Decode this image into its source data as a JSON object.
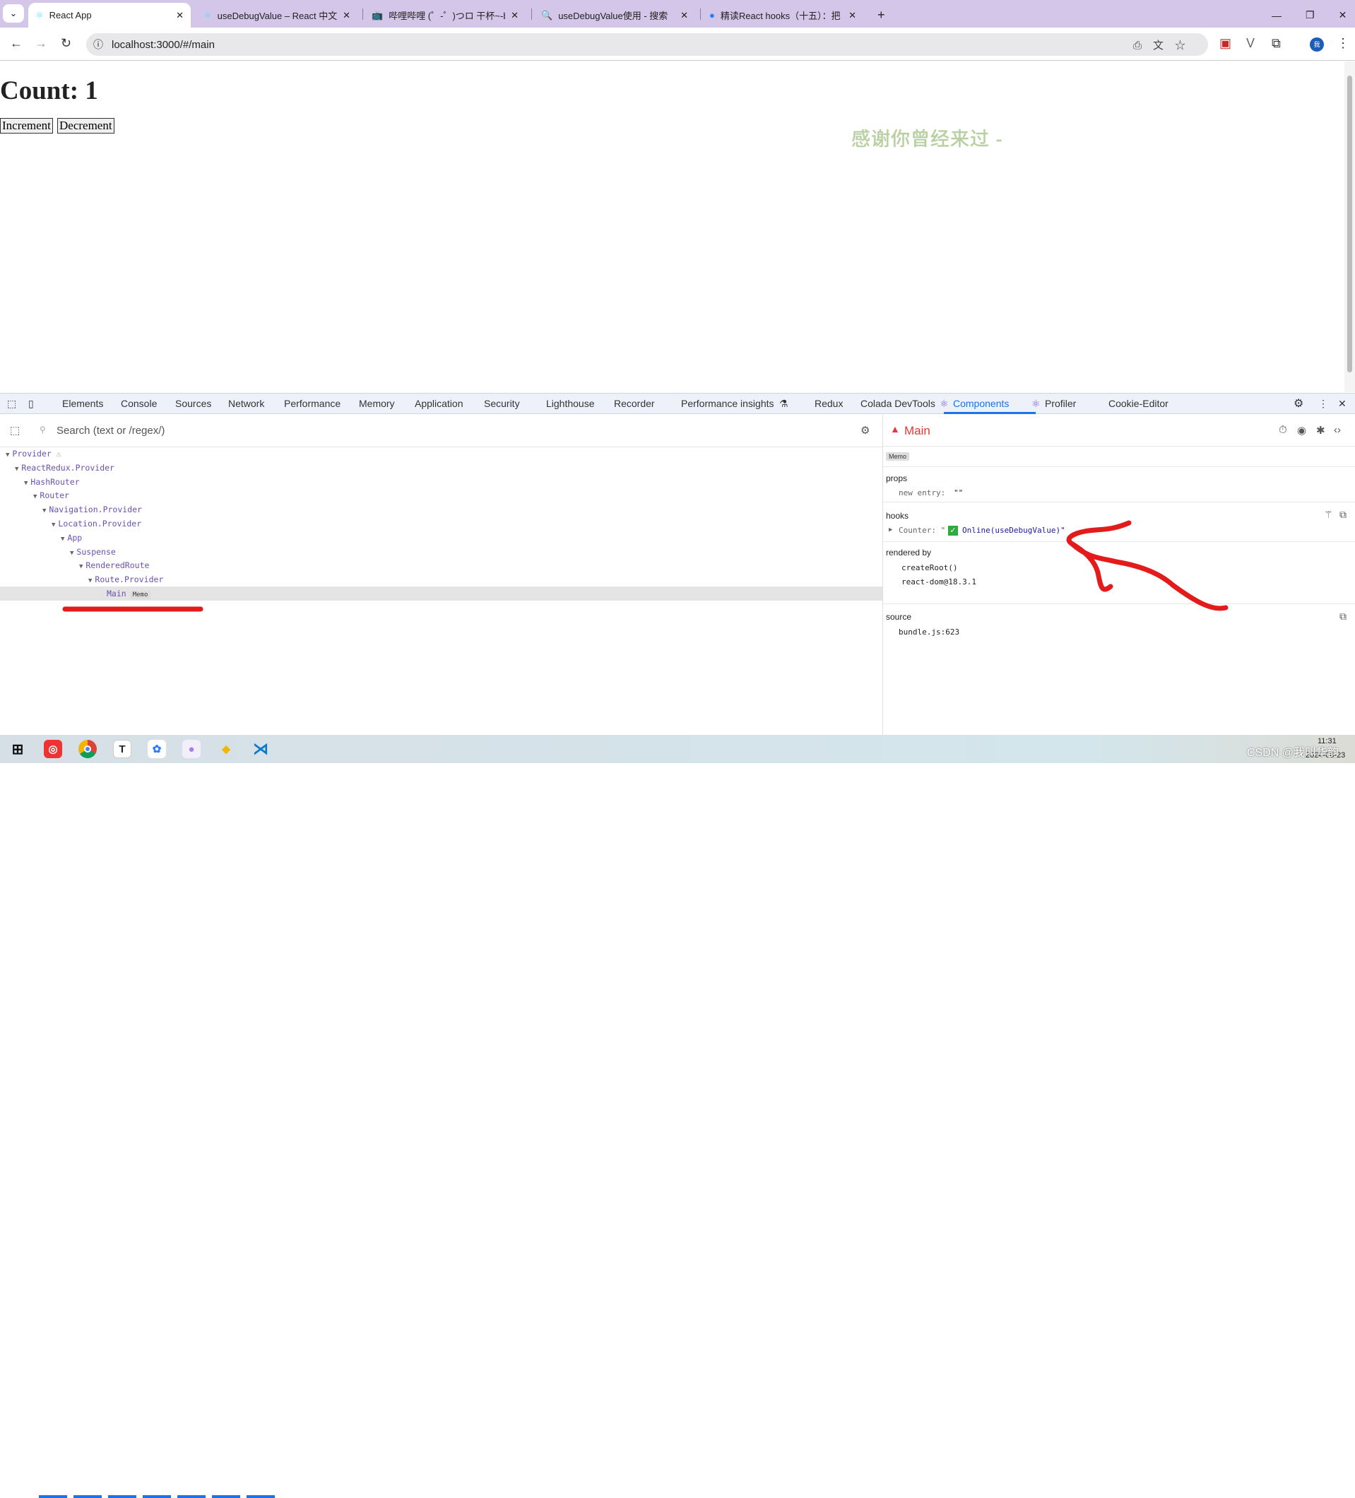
{
  "browser": {
    "tabs": [
      {
        "title": "React App",
        "active": true
      },
      {
        "title": "useDebugValue – React 中文文档"
      },
      {
        "title": "哔哩哔哩 (゜-゜)つロ 干杯~-bilibili"
      },
      {
        "title": "useDebugValue使用 - 搜索"
      },
      {
        "title": "精读React hooks（十五）：把"
      }
    ],
    "new_tab": "+",
    "url": "localhost:3000/#/main"
  },
  "page": {
    "heading": "Count: 1",
    "buttons": [
      "Increment",
      "Decrement"
    ],
    "decoration_text": "感谢你曾经来过 -"
  },
  "devtools": {
    "tabs": [
      "Elements",
      "Console",
      "Sources",
      "Network",
      "Performance",
      "Memory",
      "Application",
      "Security",
      "Lighthouse",
      "Recorder",
      "Performance insights",
      "Redux",
      "Colada DevTools",
      "Components",
      "Profiler",
      "Cookie-Editor"
    ],
    "selected_tab": "Components",
    "search_placeholder": "Search (text or /regex/)",
    "tree": [
      {
        "name": "Provider",
        "depth": 0,
        "warning": true
      },
      {
        "name": "ReactRedux.Provider",
        "depth": 1
      },
      {
        "name": "HashRouter",
        "depth": 2
      },
      {
        "name": "Router",
        "depth": 3
      },
      {
        "name": "Navigation.Provider",
        "depth": 4
      },
      {
        "name": "Location.Provider",
        "depth": 5
      },
      {
        "name": "App",
        "depth": 6
      },
      {
        "name": "Suspense",
        "depth": 7
      },
      {
        "name": "RenderedRoute",
        "depth": 8
      },
      {
        "name": "Route.Provider",
        "depth": 9
      },
      {
        "name": "Main",
        "depth": 10,
        "badge": "Memo",
        "selected": true
      }
    ],
    "inspector": {
      "title": "Main",
      "badge": "Memo",
      "props_label": "props",
      "props": [
        {
          "key": "new entry",
          "value": "\"\""
        }
      ],
      "hooks_label": "hooks",
      "hooks": [
        {
          "key": "Counter",
          "value_prefix": "\"",
          "value": "Online(useDebugValue)\""
        }
      ],
      "rendered_by_label": "rendered by",
      "rendered_by": [
        "createRoot()",
        "react-dom@18.3.1"
      ],
      "source_label": "source",
      "source": "bundle.js:623"
    }
  },
  "taskbar": {
    "time": "11:31",
    "date": "2024-06-23",
    "watermark": "CSDN @我叫华韵"
  },
  "colors": {
    "accent": "#1a73e8",
    "annotation": "#e31b1b",
    "component": "#6a51b2",
    "warning": "#e53935"
  }
}
